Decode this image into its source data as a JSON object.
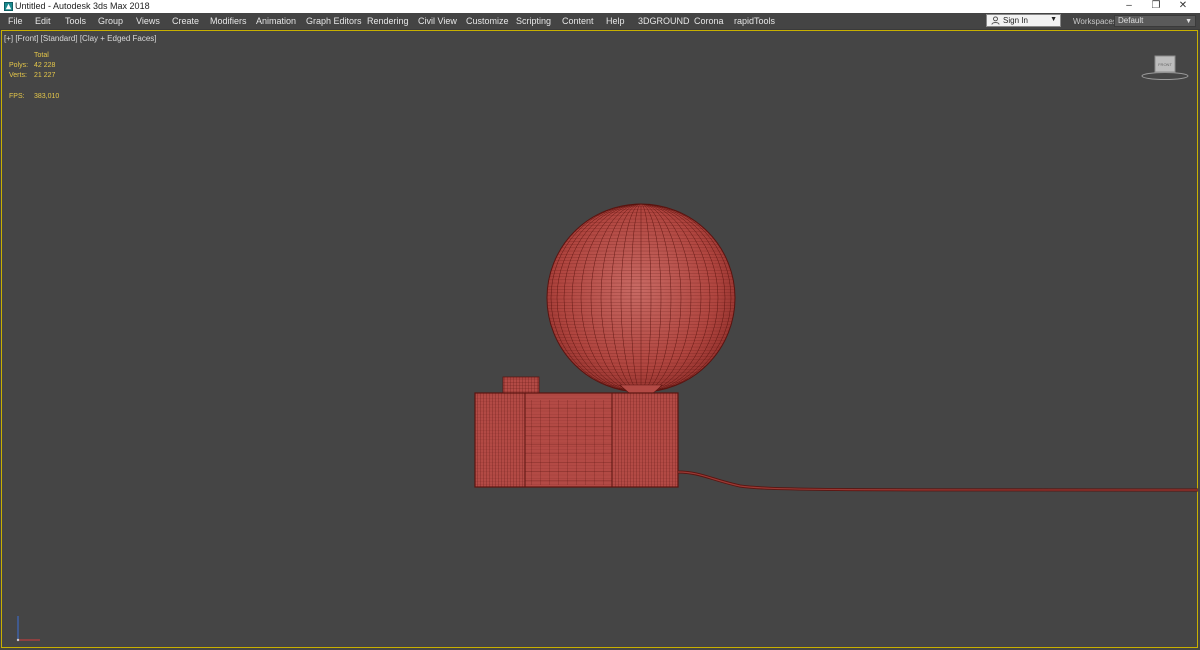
{
  "titlebar": {
    "title": "Untitled - Autodesk 3ds Max 2018",
    "minimize_glyph": "–",
    "restore_glyph": "❐",
    "close_glyph": "✕"
  },
  "menu": {
    "items": [
      "File",
      "Edit",
      "Tools",
      "Group",
      "Views",
      "Create",
      "Modifiers",
      "Animation",
      "Graph Editors",
      "Rendering",
      "Civil View",
      "Customize",
      "Scripting",
      "Content",
      "Help",
      "3DGROUND",
      "Corona",
      "rapidTools"
    ]
  },
  "account": {
    "sign_in_label": "Sign In",
    "dropdown_caret": "▼"
  },
  "workspaces": {
    "label": "Workspaces:",
    "value": "Default",
    "caret": "▼"
  },
  "viewport": {
    "label": "[+] [Front] [Standard] [Clay + Edged Faces]",
    "stats": {
      "header": "Total",
      "polys_label": "Polys:",
      "polys_value": "42 228",
      "verts_label": "Verts:",
      "verts_value": "21 227",
      "fps_label": "FPS:",
      "fps_value": "383,010"
    },
    "viewcube_face": "FRONT"
  },
  "colors": {
    "viewport_bg": "#454545",
    "active_border": "#c8b000",
    "clay": "#b34a45",
    "wire": "#5a1410",
    "stats_text": "#e6c84a"
  }
}
